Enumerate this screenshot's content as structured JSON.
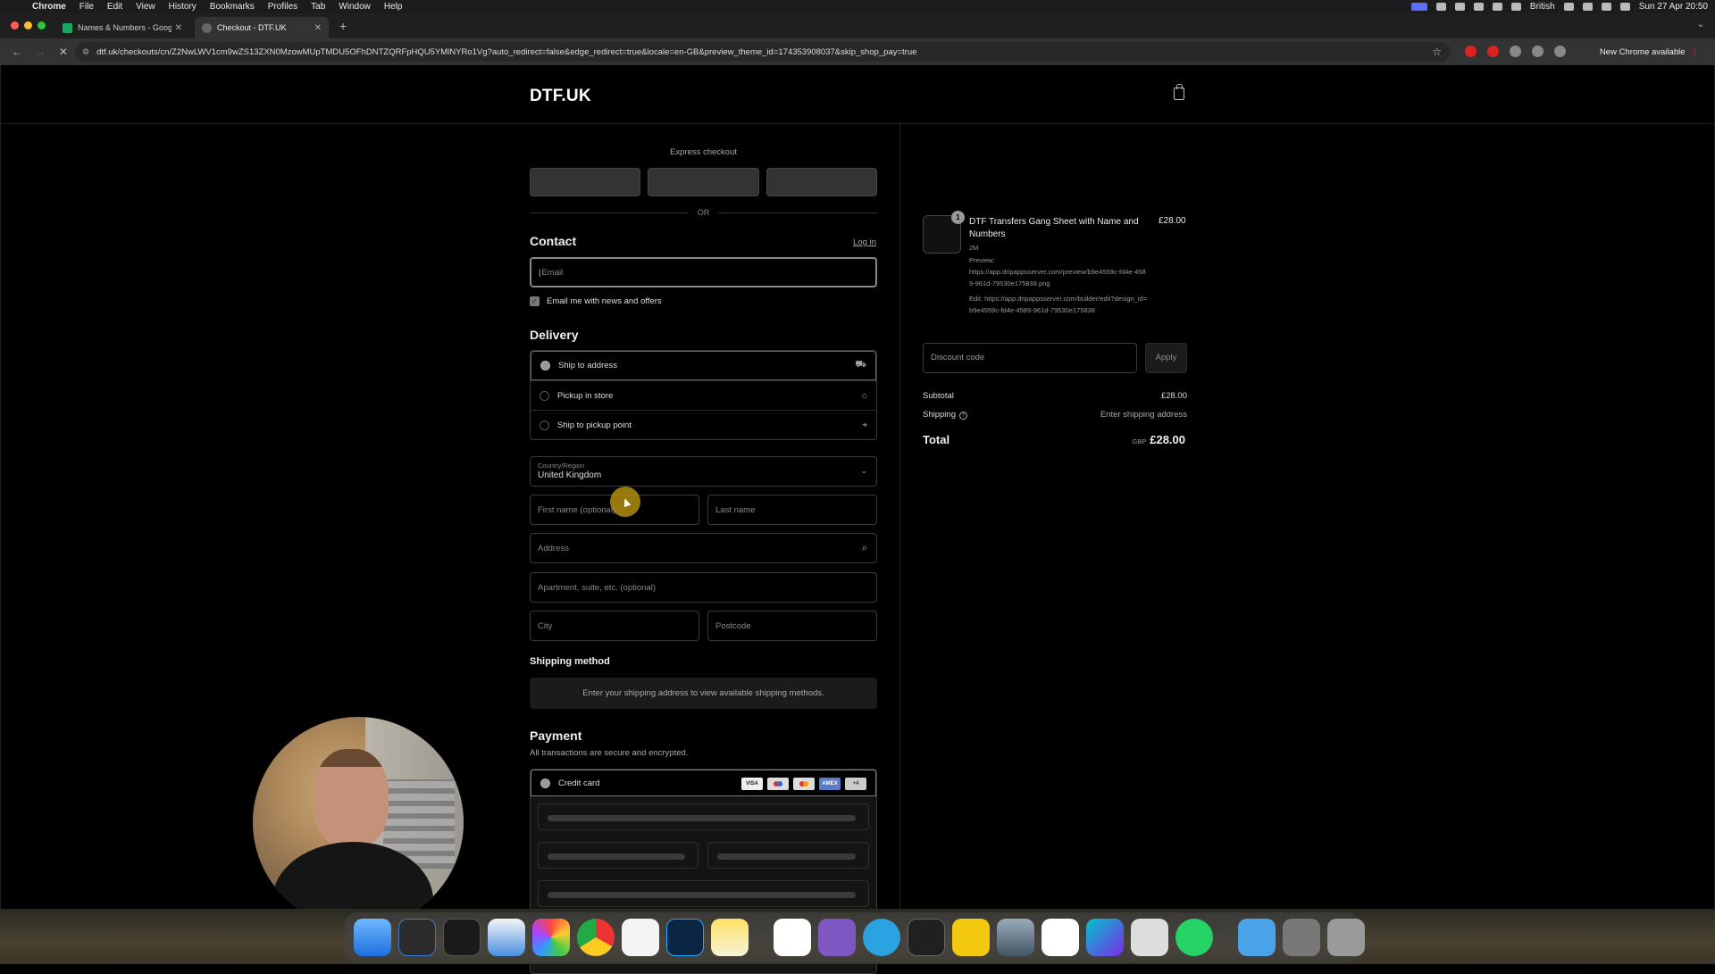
{
  "menubar": {
    "app": "Chrome",
    "items": [
      "File",
      "Edit",
      "View",
      "History",
      "Bookmarks",
      "Profiles",
      "Tab",
      "Window",
      "Help"
    ],
    "input_source": "British",
    "datetime": "Sun 27 Apr  20:50"
  },
  "tabs": [
    {
      "title": "Names & Numbers - Google",
      "active": false
    },
    {
      "title": "Checkout - DTF.UK",
      "active": true
    }
  ],
  "address_bar": {
    "url": "dtf.uk/checkouts/cn/Z2NwLWV1cm9wZS13ZXN0MzowMUpTMDU5OFhDNTZQRFpHQU5YMlNYRo1Vg?auto_redirect=false&edge_redirect=true&locale=en-GB&preview_theme_id=174353908037&skip_shop_pay=true",
    "new_chrome": "New Chrome available"
  },
  "store": {
    "logo": "DTF.UK"
  },
  "express": {
    "title": "Express checkout",
    "or": "OR"
  },
  "contact": {
    "heading": "Contact",
    "login": "Log in",
    "email_placeholder": "Email",
    "newsletter": "Email me with news and offers"
  },
  "delivery": {
    "heading": "Delivery",
    "options": [
      {
        "label": "Ship to address",
        "selected": true
      },
      {
        "label": "Pickup in store",
        "selected": false
      },
      {
        "label": "Ship to pickup point",
        "selected": false
      }
    ],
    "country_label": "Country/Region",
    "country_value": "United Kingdom",
    "first_name": "First name (optional)",
    "last_name": "Last name",
    "address": "Address",
    "apartment": "Apartment, suite, etc. (optional)",
    "city": "City",
    "postcode": "Postcode"
  },
  "shipping_method": {
    "heading": "Shipping method",
    "message": "Enter your shipping address to view available shipping methods."
  },
  "payment": {
    "heading": "Payment",
    "subtitle": "All transactions are secure and encrypted.",
    "method": "Credit card",
    "cards": [
      "VISA",
      "Maestro",
      "Mastercard",
      "AMEX",
      "+4"
    ]
  },
  "summary": {
    "quantity": "1",
    "product_name": "DTF Transfers Gang Sheet with Name and Numbers",
    "size": "2M",
    "preview_label": "Preview:",
    "preview_url": "https://app.dripappsserver.com/preview/b9e4559c-fd4e-4589-961d-79530e175838.png",
    "edit_label": "Edit:",
    "edit_url": "https://app.dripappsserver.com/builder/edit?design_id=b9e4559c-fd4e-4589-961d-79530e175838",
    "price": "£28.00",
    "discount_placeholder": "Discount code",
    "apply": "Apply",
    "subtotal_label": "Subtotal",
    "subtotal": "£28.00",
    "shipping_label": "Shipping",
    "shipping_value": "Enter shipping address",
    "total_label": "Total",
    "currency": "GBP",
    "total": "£28.00"
  },
  "colors": {
    "page_bg": "#000000",
    "text": "#e6e6e6",
    "muted": "#888888"
  }
}
